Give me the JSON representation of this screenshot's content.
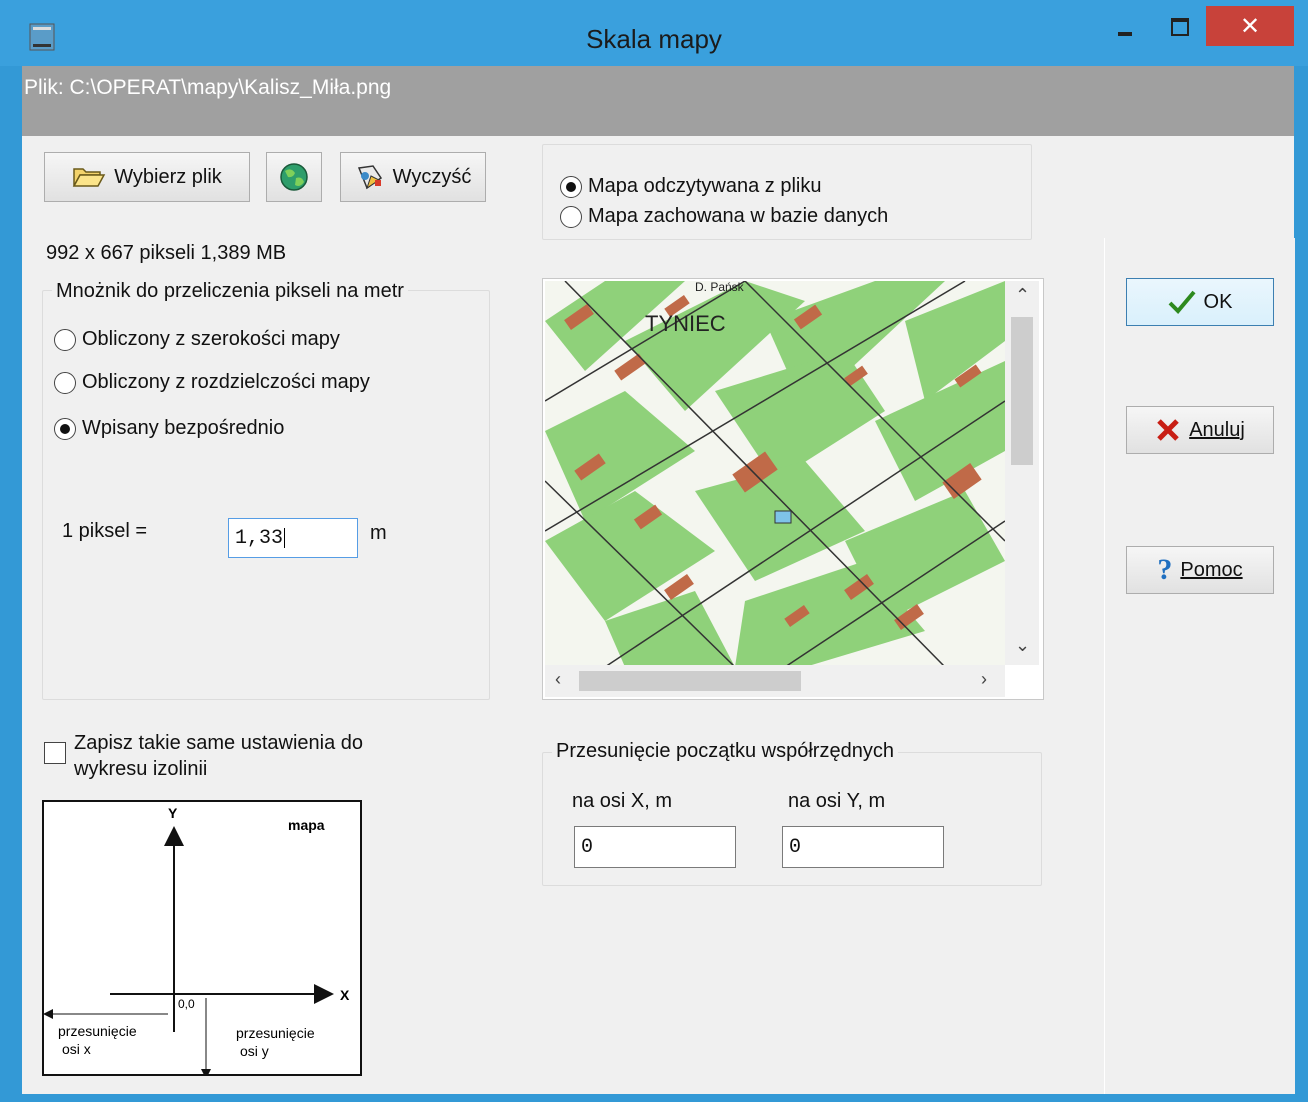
{
  "window": {
    "title": "Skala mapy",
    "close_symbol": "✕"
  },
  "file": {
    "label": "Plik: C:\\OPERAT\\mapy\\Kalisz_Miła.png"
  },
  "toolbar": {
    "choose_file_label": "Wybierz plik",
    "clear_label": "Wyczyść",
    "choose_file_icon": "folder-open-icon",
    "globe_icon": "globe-icon",
    "clear_icon": "eraser-icon"
  },
  "image_info": {
    "text": "992  x 667 pikseli    1,389 MB"
  },
  "multiplier": {
    "legend": "Mnożnik  do przeliczenia pikseli na metr",
    "options": [
      {
        "label": "Obliczony z szerokości mapy",
        "selected": false
      },
      {
        "label": "Obliczony z rozdzielczości mapy",
        "selected": false
      },
      {
        "label": "Wpisany bezpośrednio",
        "selected": true
      }
    ],
    "pixel_label": "1 piksel =",
    "pixel_value": "1,33",
    "unit": "m"
  },
  "source": {
    "options": [
      {
        "label": "Mapa odczytywana z pliku",
        "selected": true
      },
      {
        "label": "Mapa zachowana w bazie danych",
        "selected": false
      }
    ]
  },
  "map_preview": {
    "place_label": "TYNIEC",
    "top_label": "D. Pańsk"
  },
  "save_settings": {
    "label": "Zapisz takie same ustawienia  do\nwykresu izolinii",
    "checked": false
  },
  "offset": {
    "legend": "Przesunięcie początku współrzędnych",
    "x_label": "na osi X, m",
    "y_label": "na osi Y, m",
    "x_value": "0",
    "y_value": "0"
  },
  "actions": {
    "ok_label": "OK",
    "cancel_label": "Anuluj",
    "help_label": "Pomoc",
    "ok_icon": "checkmark-icon",
    "cancel_icon": "x-mark-icon",
    "help_icon": "question-mark-icon"
  },
  "diagram": {
    "map_label": "mapa",
    "y_axis": "Y",
    "x_axis": "X",
    "origin": "0,0",
    "shift_x": "przesunięcie\nosi x",
    "shift_y": "przesunięcie\nosi y"
  },
  "colors": {
    "title_bar": "#3aa0dd",
    "close_button": "#c8423a",
    "file_bar": "#a0a0a0",
    "map_green": "#8fd17a",
    "map_building": "#c06a48"
  }
}
